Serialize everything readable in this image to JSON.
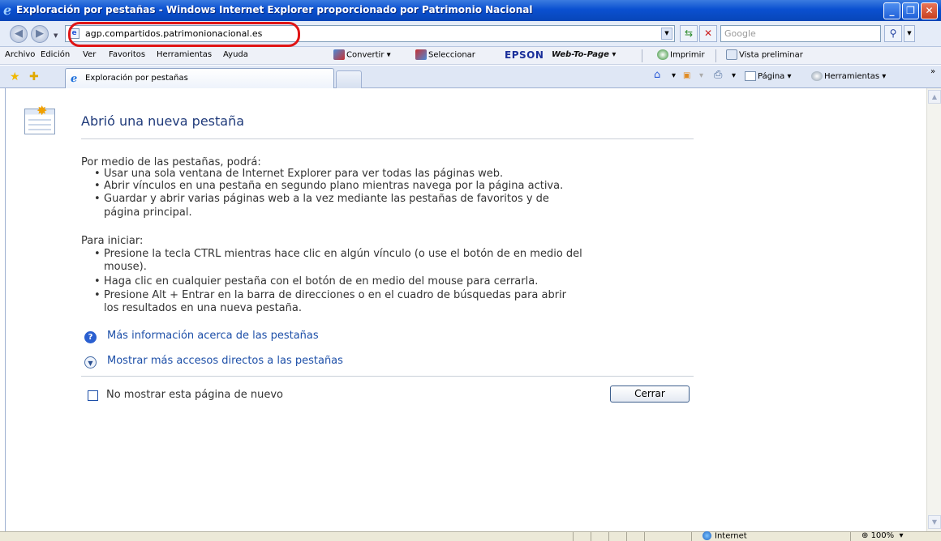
{
  "window": {
    "title": "Exploración por pestañas - Windows Internet Explorer proporcionado por Patrimonio Nacional",
    "controls": [
      "minimize",
      "restore",
      "close"
    ]
  },
  "address_bar": {
    "url": "agp.compartidos.patrimonionacional.es",
    "search_placeholder": "Google"
  },
  "menu": {
    "items": [
      "Archivo",
      "Edición",
      "Ver",
      "Favoritos",
      "Herramientas",
      "Ayuda"
    ],
    "convertir": "Convertir",
    "seleccionar": "Seleccionar",
    "epson": "EPSON",
    "web_to_page": "Web-To-Page",
    "imprimir": "Imprimir",
    "vista_preliminar": "Vista preliminar"
  },
  "tabs": {
    "active_label": "Exploración por pestañas",
    "commands": {
      "pagina": "Página",
      "herramientas": "Herramientas",
      "overflow": "»"
    }
  },
  "content": {
    "heading": "Abrió una nueva pestaña",
    "intro": "Por medio de las pestañas, podrá:",
    "intro_bullets": [
      "Usar una sola ventana de Internet Explorer para ver todas las páginas web.",
      "Abrir vínculos en una pestaña en segundo plano mientras navega por la página activa.",
      "Guardar y abrir varias páginas web a la vez mediante las pestañas de favoritos y de",
      "página principal."
    ],
    "start": "Para iniciar:",
    "start_bullets": [
      "Presione la tecla CTRL mientras hace clic en algún vínculo (o use el botón de en medio del",
      "mouse).",
      "Haga clic en cualquier pestaña con el botón de en medio del mouse para cerrarla.",
      "Presione Alt + Entrar en la barra de direcciones o en el cuadro de búsquedas para abrir",
      "los resultados en una nueva pestaña."
    ],
    "more_info_link": "Más información acerca de las pestañas",
    "shortcuts_link": "Mostrar más accesos directos a las pestañas",
    "dont_show_label": "No mostrar esta página de nuevo",
    "close_button": "Cerrar"
  },
  "status_bar": {
    "zone": "Internet",
    "zoom": "100%"
  },
  "colors": {
    "titlebar": "#0a50d0",
    "heading": "#1f3a7a",
    "link": "#1d4fa8",
    "annotation": "#e01515"
  }
}
